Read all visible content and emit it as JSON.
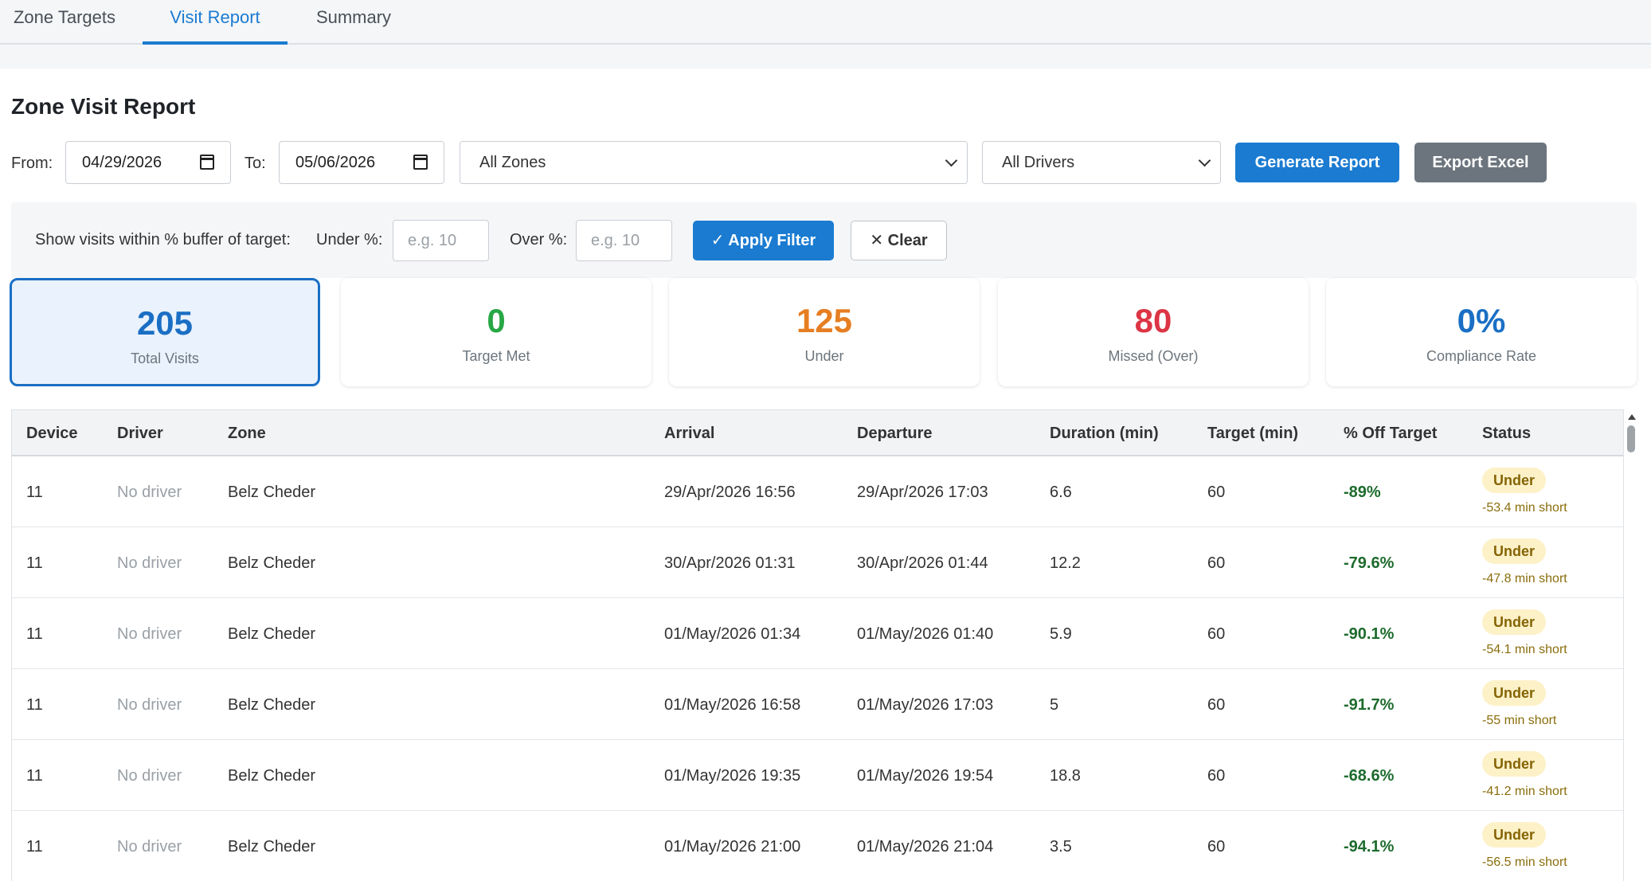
{
  "tabs": [
    {
      "label": "Zone Targets",
      "active": false
    },
    {
      "label": "Visit Report",
      "active": true
    },
    {
      "label": "Summary",
      "active": false
    }
  ],
  "page_title": "Zone Visit Report",
  "filters": {
    "from_label": "From:",
    "from_value": "04/29/2026",
    "to_label": "To:",
    "to_value": "05/06/2026",
    "zone_select": "All Zones",
    "driver_select": "All Drivers",
    "generate_label": "Generate Report",
    "export_label": "Export Excel"
  },
  "buffer": {
    "label": "Show visits within % buffer of target:",
    "under_label": "Under %:",
    "under_placeholder": "e.g. 10",
    "over_label": "Over %:",
    "over_placeholder": "e.g. 10",
    "apply_label": "✓ Apply Filter",
    "clear_label": "✕ Clear"
  },
  "stats": [
    {
      "value": "205",
      "caption": "Total Visits",
      "color": "#1a6fc4"
    },
    {
      "value": "0",
      "caption": "Target Met",
      "color": "#28a745"
    },
    {
      "value": "125",
      "caption": "Under",
      "color": "#e67e22"
    },
    {
      "value": "80",
      "caption": "Missed (Over)",
      "color": "#dc3545"
    },
    {
      "value": "0%",
      "caption": "Compliance Rate",
      "color": "#1a6fc4"
    }
  ],
  "table": {
    "headers": [
      "Device",
      "Driver",
      "Zone",
      "Arrival",
      "Departure",
      "Duration (min)",
      "Target (min)",
      "% Off Target",
      "Status"
    ],
    "rows": [
      {
        "device": "11",
        "driver": "No driver",
        "zone": "Belz Cheder",
        "arrival": "29/Apr/2026 16:56",
        "departure": "29/Apr/2026 17:03",
        "duration": "6.6",
        "target": "60",
        "pct": "-89%",
        "status": "Under",
        "note": "-53.4 min short"
      },
      {
        "device": "11",
        "driver": "No driver",
        "zone": "Belz Cheder",
        "arrival": "30/Apr/2026 01:31",
        "departure": "30/Apr/2026 01:44",
        "duration": "12.2",
        "target": "60",
        "pct": "-79.6%",
        "status": "Under",
        "note": "-47.8 min short"
      },
      {
        "device": "11",
        "driver": "No driver",
        "zone": "Belz Cheder",
        "arrival": "01/May/2026 01:34",
        "departure": "01/May/2026 01:40",
        "duration": "5.9",
        "target": "60",
        "pct": "-90.1%",
        "status": "Under",
        "note": "-54.1 min short"
      },
      {
        "device": "11",
        "driver": "No driver",
        "zone": "Belz Cheder",
        "arrival": "01/May/2026 16:58",
        "departure": "01/May/2026 17:03",
        "duration": "5",
        "target": "60",
        "pct": "-91.7%",
        "status": "Under",
        "note": "-55 min short"
      },
      {
        "device": "11",
        "driver": "No driver",
        "zone": "Belz Cheder",
        "arrival": "01/May/2026 19:35",
        "departure": "01/May/2026 19:54",
        "duration": "18.8",
        "target": "60",
        "pct": "-68.6%",
        "status": "Under",
        "note": "-41.2 min short"
      },
      {
        "device": "11",
        "driver": "No driver",
        "zone": "Belz Cheder",
        "arrival": "01/May/2026 21:00",
        "departure": "01/May/2026 21:04",
        "duration": "3.5",
        "target": "60",
        "pct": "-94.1%",
        "status": "Under",
        "note": "-56.5 min short"
      }
    ]
  }
}
